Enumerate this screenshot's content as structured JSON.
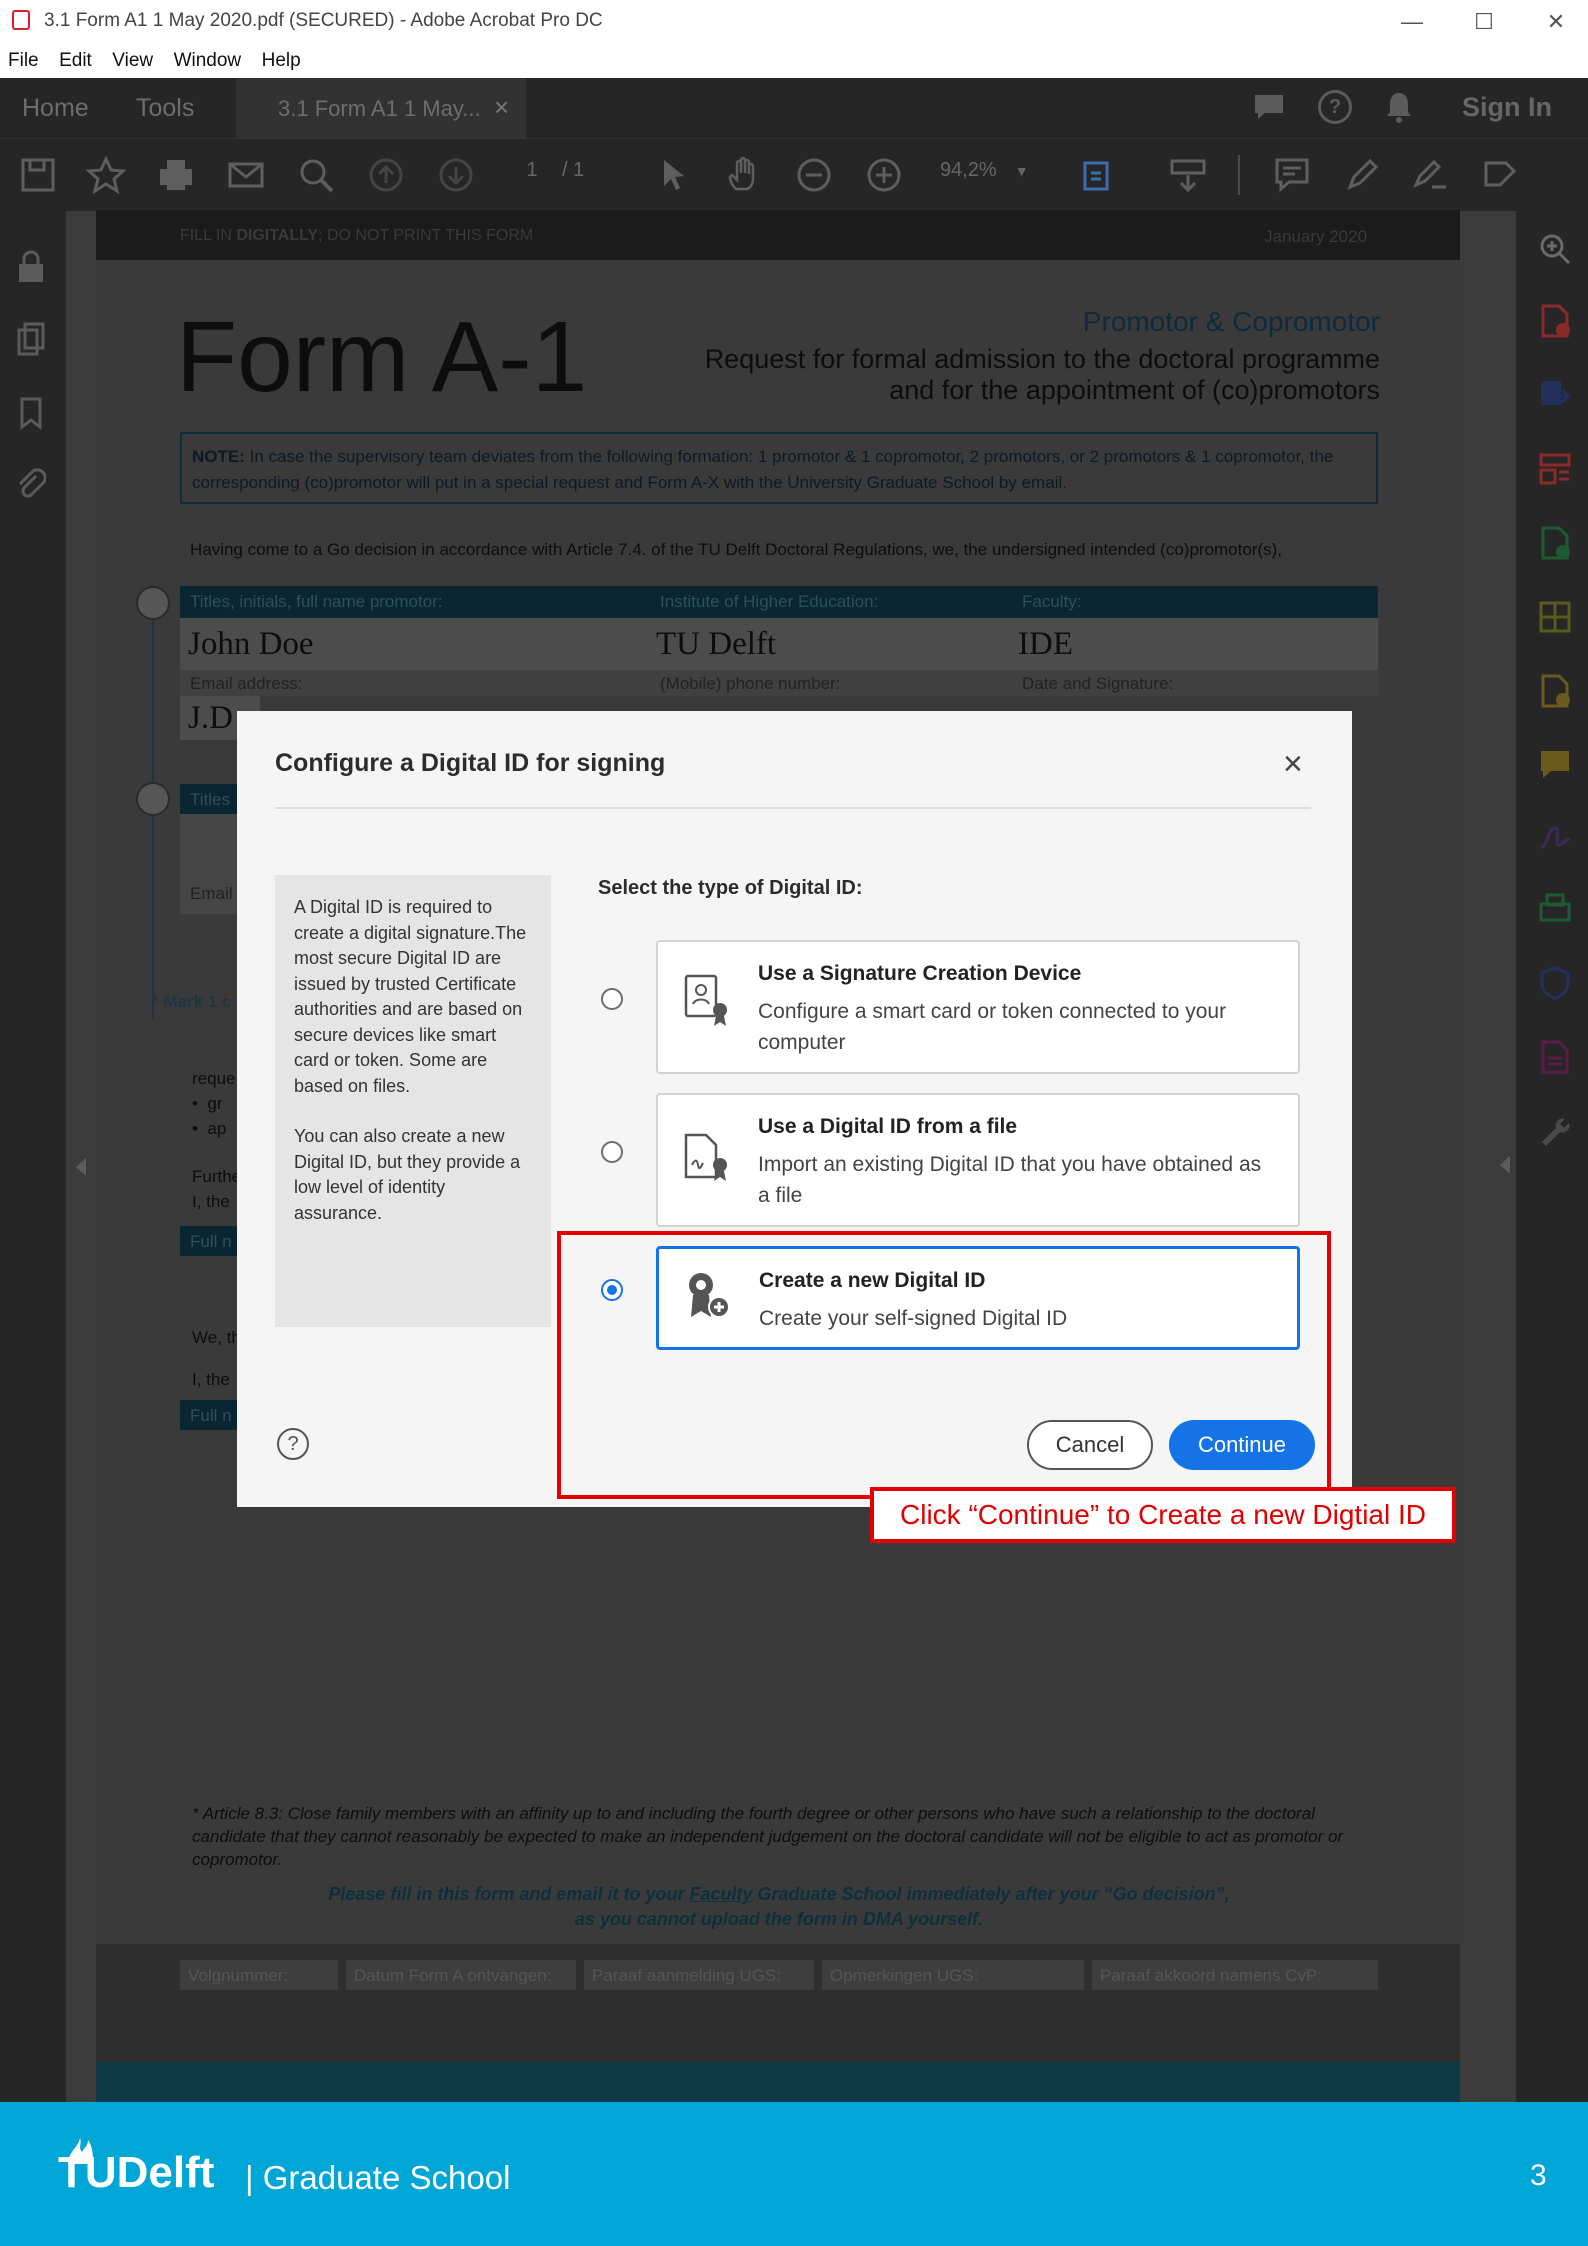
{
  "window": {
    "title": "3.1 Form A1 1 May 2020.pdf (SECURED) - Adobe Acrobat Pro DC",
    "minimize": "—",
    "maximize": "☐",
    "close": "✕"
  },
  "menubar": [
    "File",
    "Edit",
    "View",
    "Window",
    "Help"
  ],
  "tabs": {
    "home": "Home",
    "tools": "Tools",
    "document": "3.1 Form A1 1 May...",
    "document_close": "×",
    "sign_in": "Sign In"
  },
  "toolbar": {
    "page_current": "1",
    "page_total": "/ 1",
    "zoom": "94,2%"
  },
  "document": {
    "header_left_1": "FILL IN ",
    "header_left_2": "DIGITALLY",
    "header_left_3": "; DO NOT PRINT THIS FORM",
    "header_right": "January 2020",
    "form_title": "Form A-1",
    "subtitle_accent": "Promotor & Copromotor",
    "subtitle_line1": "Request for formal admission to the doctoral programme",
    "subtitle_line2": "and for the appointment of (co)promotors",
    "note_label": "NOTE:",
    "note_text": " In case the supervisory team deviates from the following formation: 1 promotor & 1 copromotor, 2 promotors, or 2 promotors & 1 copromotor, the corresponding (co)promotor will put in a special request and Form A-X with the University Graduate School by email.",
    "intro_text": "Having come to a Go decision in accordance with Article 7.4. of the TU Delft Doctoral Regulations, we, the undersigned intended (co)promotor(s),",
    "field_name_label": "Titles, initials, full name promotor:",
    "field_institute_label": "Institute of Higher Education:",
    "field_faculty_label": "Faculty:",
    "field_name_value": "John Doe",
    "field_institute_value": "TU Delft",
    "field_faculty_value": "IDE",
    "field_email_label": "Email address:",
    "field_phone_label": "(Mobile) phone number:",
    "field_date_label": "Date and Signature:",
    "field_email_value": "J.D",
    "titles_fragment": "Titles",
    "email_fragment": "Email",
    "mark_fragment": "* Mark 1 c",
    "reque_fragment": "reque",
    "bullet1": "gr",
    "bullet2": "ap",
    "furth_fragment": "Furthe",
    "ithe_fragment": "I, the",
    "fulln_fragment": "Full n",
    "we_fragment": "We, th",
    "ithe2_fragment": "I, the",
    "fulln2_fragment": "Full n",
    "footnote": "* Article 8.3: Close family members with an affinity up to and including the fourth degree or other persons who have such a relationship to the doctoral candidate that they cannot reasonably be expected to make an independent judgement on the doctoral candidate will not be eligible to act as promotor or copromotor.",
    "instruction_line1_a": "Please fill in this form and email it to your ",
    "instruction_line1_b": "Faculty",
    "instruction_line1_c": " Graduate School immediately after your “Go decision”,",
    "instruction_line2": "as you cannot upload the form in DMA yourself.",
    "admin_cols": [
      "Volgnummer:",
      "Datum Form A ontvangen:",
      "Paraaf aanmelding UGS:",
      "Opmerkingen UGS:",
      "Paraaf akkoord namens CvP:"
    ]
  },
  "dialog": {
    "title": "Configure a Digital ID for signing",
    "close": "×",
    "info_p1": "A Digital ID is required to create a digital signature.The most secure Digital ID are issued by trusted Certificate authorities and are based on secure devices like smart card or token. Some are based on files.",
    "info_p2": "You can also create a new Digital ID, but they provide a low level of identity assurance.",
    "select_label": "Select the type of Digital ID:",
    "options": [
      {
        "title": "Use a Signature Creation Device",
        "desc": "Configure a smart card or token connected to your computer",
        "selected": false
      },
      {
        "title": "Use a Digital ID from a file",
        "desc": "Import an existing Digital ID that you have obtained as a file",
        "selected": false
      },
      {
        "title": "Create a new Digital ID",
        "desc": "Create your self-signed Digital ID",
        "selected": true
      }
    ],
    "help": "?",
    "cancel": "Cancel",
    "continue": "Continue"
  },
  "annotation": {
    "callout": "Click “Continue” to Create a new Digtial ID"
  },
  "footer": {
    "brand": "TUDelft",
    "unit": "| Graduate School",
    "slide_number": "3"
  },
  "colors": {
    "acrobat_dark": "#262626",
    "accent_blue": "#1473e6",
    "annotation_red": "#e20000",
    "tud_cyan": "#00a6d6"
  }
}
